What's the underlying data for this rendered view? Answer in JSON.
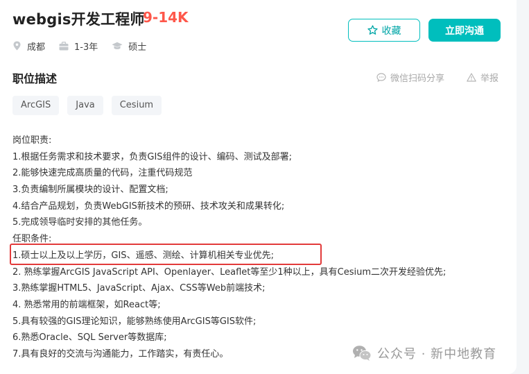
{
  "header": {
    "title": "webgis开发工程师",
    "salary": "9-14K",
    "meta": {
      "city": "成都",
      "experience": "1-3年",
      "degree": "硕士"
    },
    "buttons": {
      "favorite": "收藏",
      "chat": "立即沟通"
    }
  },
  "section": {
    "title": "职位描述",
    "share": "微信扫码分享",
    "report": "举报"
  },
  "tags": [
    "ArcGIS",
    "Java",
    "Cesium"
  ],
  "description": {
    "lines": [
      "岗位职责:",
      "1.根据任务需求和技术要求，负责GIS组件的设计、编码、测试及部署;",
      "2.能够快速完成高质量的代码，注重代码规范",
      "3.负责编制所属模块的设计、配置文档;",
      "4.结合产品规划，负责WebGIS新技术的预研、技术攻关和成果转化;",
      "5.完成领导临时安排的其他任务。",
      "任职条件:",
      "1.硕士以上及以上学历，GIS、遥感、测绘、计算机相关专业优先;",
      "2. 熟练掌握ArcGIS JavaScript API、Openlayer、Leaflet等至少1种以上，具有Cesium二次开发经验优先;",
      "3.熟练掌握HTML5、JavaScript、Ajax、CSS等Web前端技术;",
      "4. 熟悉常用的前端框架，如React等;",
      "5.具有较强的GIS理论知识，能够熟练使用ArcGIS等GIS软件;",
      "6.熟悉Oracle、SQL Server等数据库;",
      "7.具有良好的交流与沟通能力，工作踏实，有责任心。"
    ]
  },
  "watermark": "公众号 · 新中地教育",
  "colors": {
    "accent": "#00bebd",
    "salary": "#fe574a",
    "highlight": "#e23a3a"
  },
  "icons": {
    "city": "location-pin-icon",
    "experience": "briefcase-icon",
    "degree": "graduation-cap-icon",
    "favorite": "star-icon",
    "share": "chat-bubble-icon",
    "report": "warning-triangle-icon",
    "watermark": "wechat-icon"
  }
}
